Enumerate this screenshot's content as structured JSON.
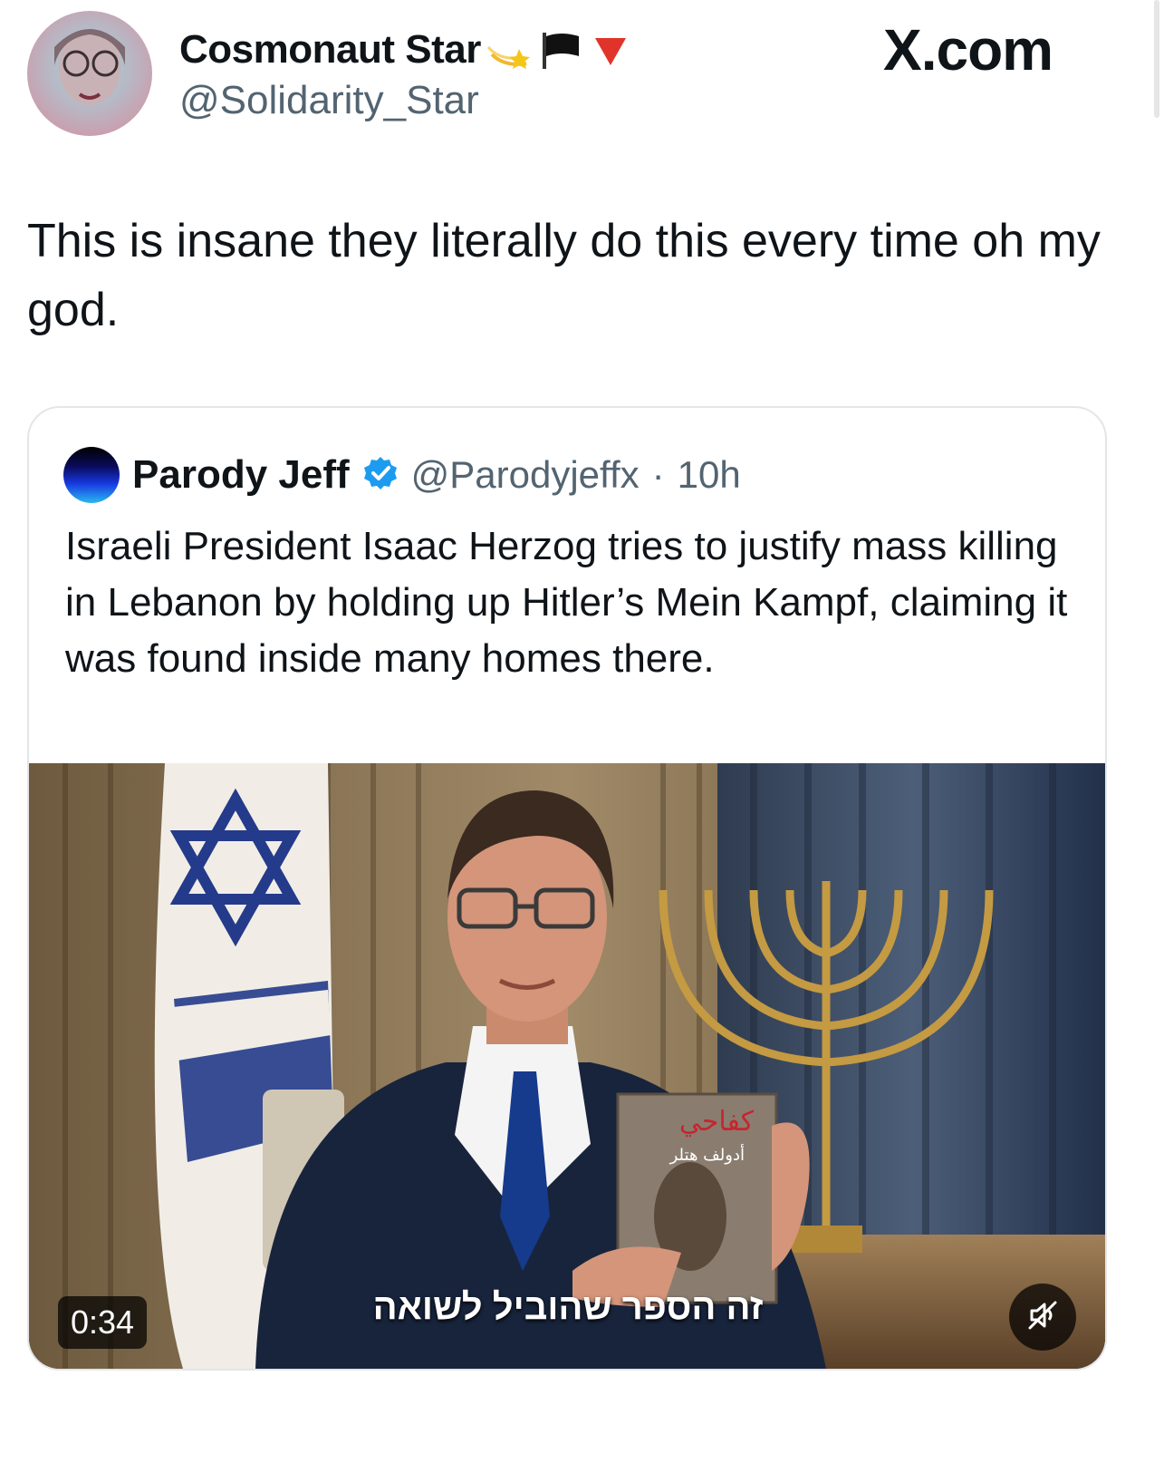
{
  "header": {
    "display_name": "Cosmonaut Star",
    "handle": "@Solidarity_Star",
    "name_emojis": [
      "shooting-star-emoji",
      "black-flag-emoji",
      "red-triangle-emoji"
    ],
    "site_watermark": "X.com"
  },
  "tweet": {
    "text": "This is insane they literally do this every time oh my god."
  },
  "quoted": {
    "display_name": "Parody Jeff",
    "verified_icon": "verified-badge-icon",
    "handle": "@Parodyjeffx",
    "separator": "·",
    "time": "10h",
    "text": "Israeli President Isaac Herzog tries to justify mass killing in Lebanon by holding up Hitler’s Mein Kampf, claiming it was found inside many homes there.",
    "video": {
      "duration": "0:34",
      "caption": "זה הספר שהוביל לשואה",
      "book_title": "كفاحي",
      "book_author": "أدولف هتلر",
      "mute_icon": "muted-speaker-icon"
    }
  },
  "colors": {
    "text_primary": "#0f1419",
    "text_secondary": "#536471",
    "verified_blue": "#1d9bf0",
    "card_border": "#e3e6e9",
    "flag_blue": "#243a8a"
  }
}
